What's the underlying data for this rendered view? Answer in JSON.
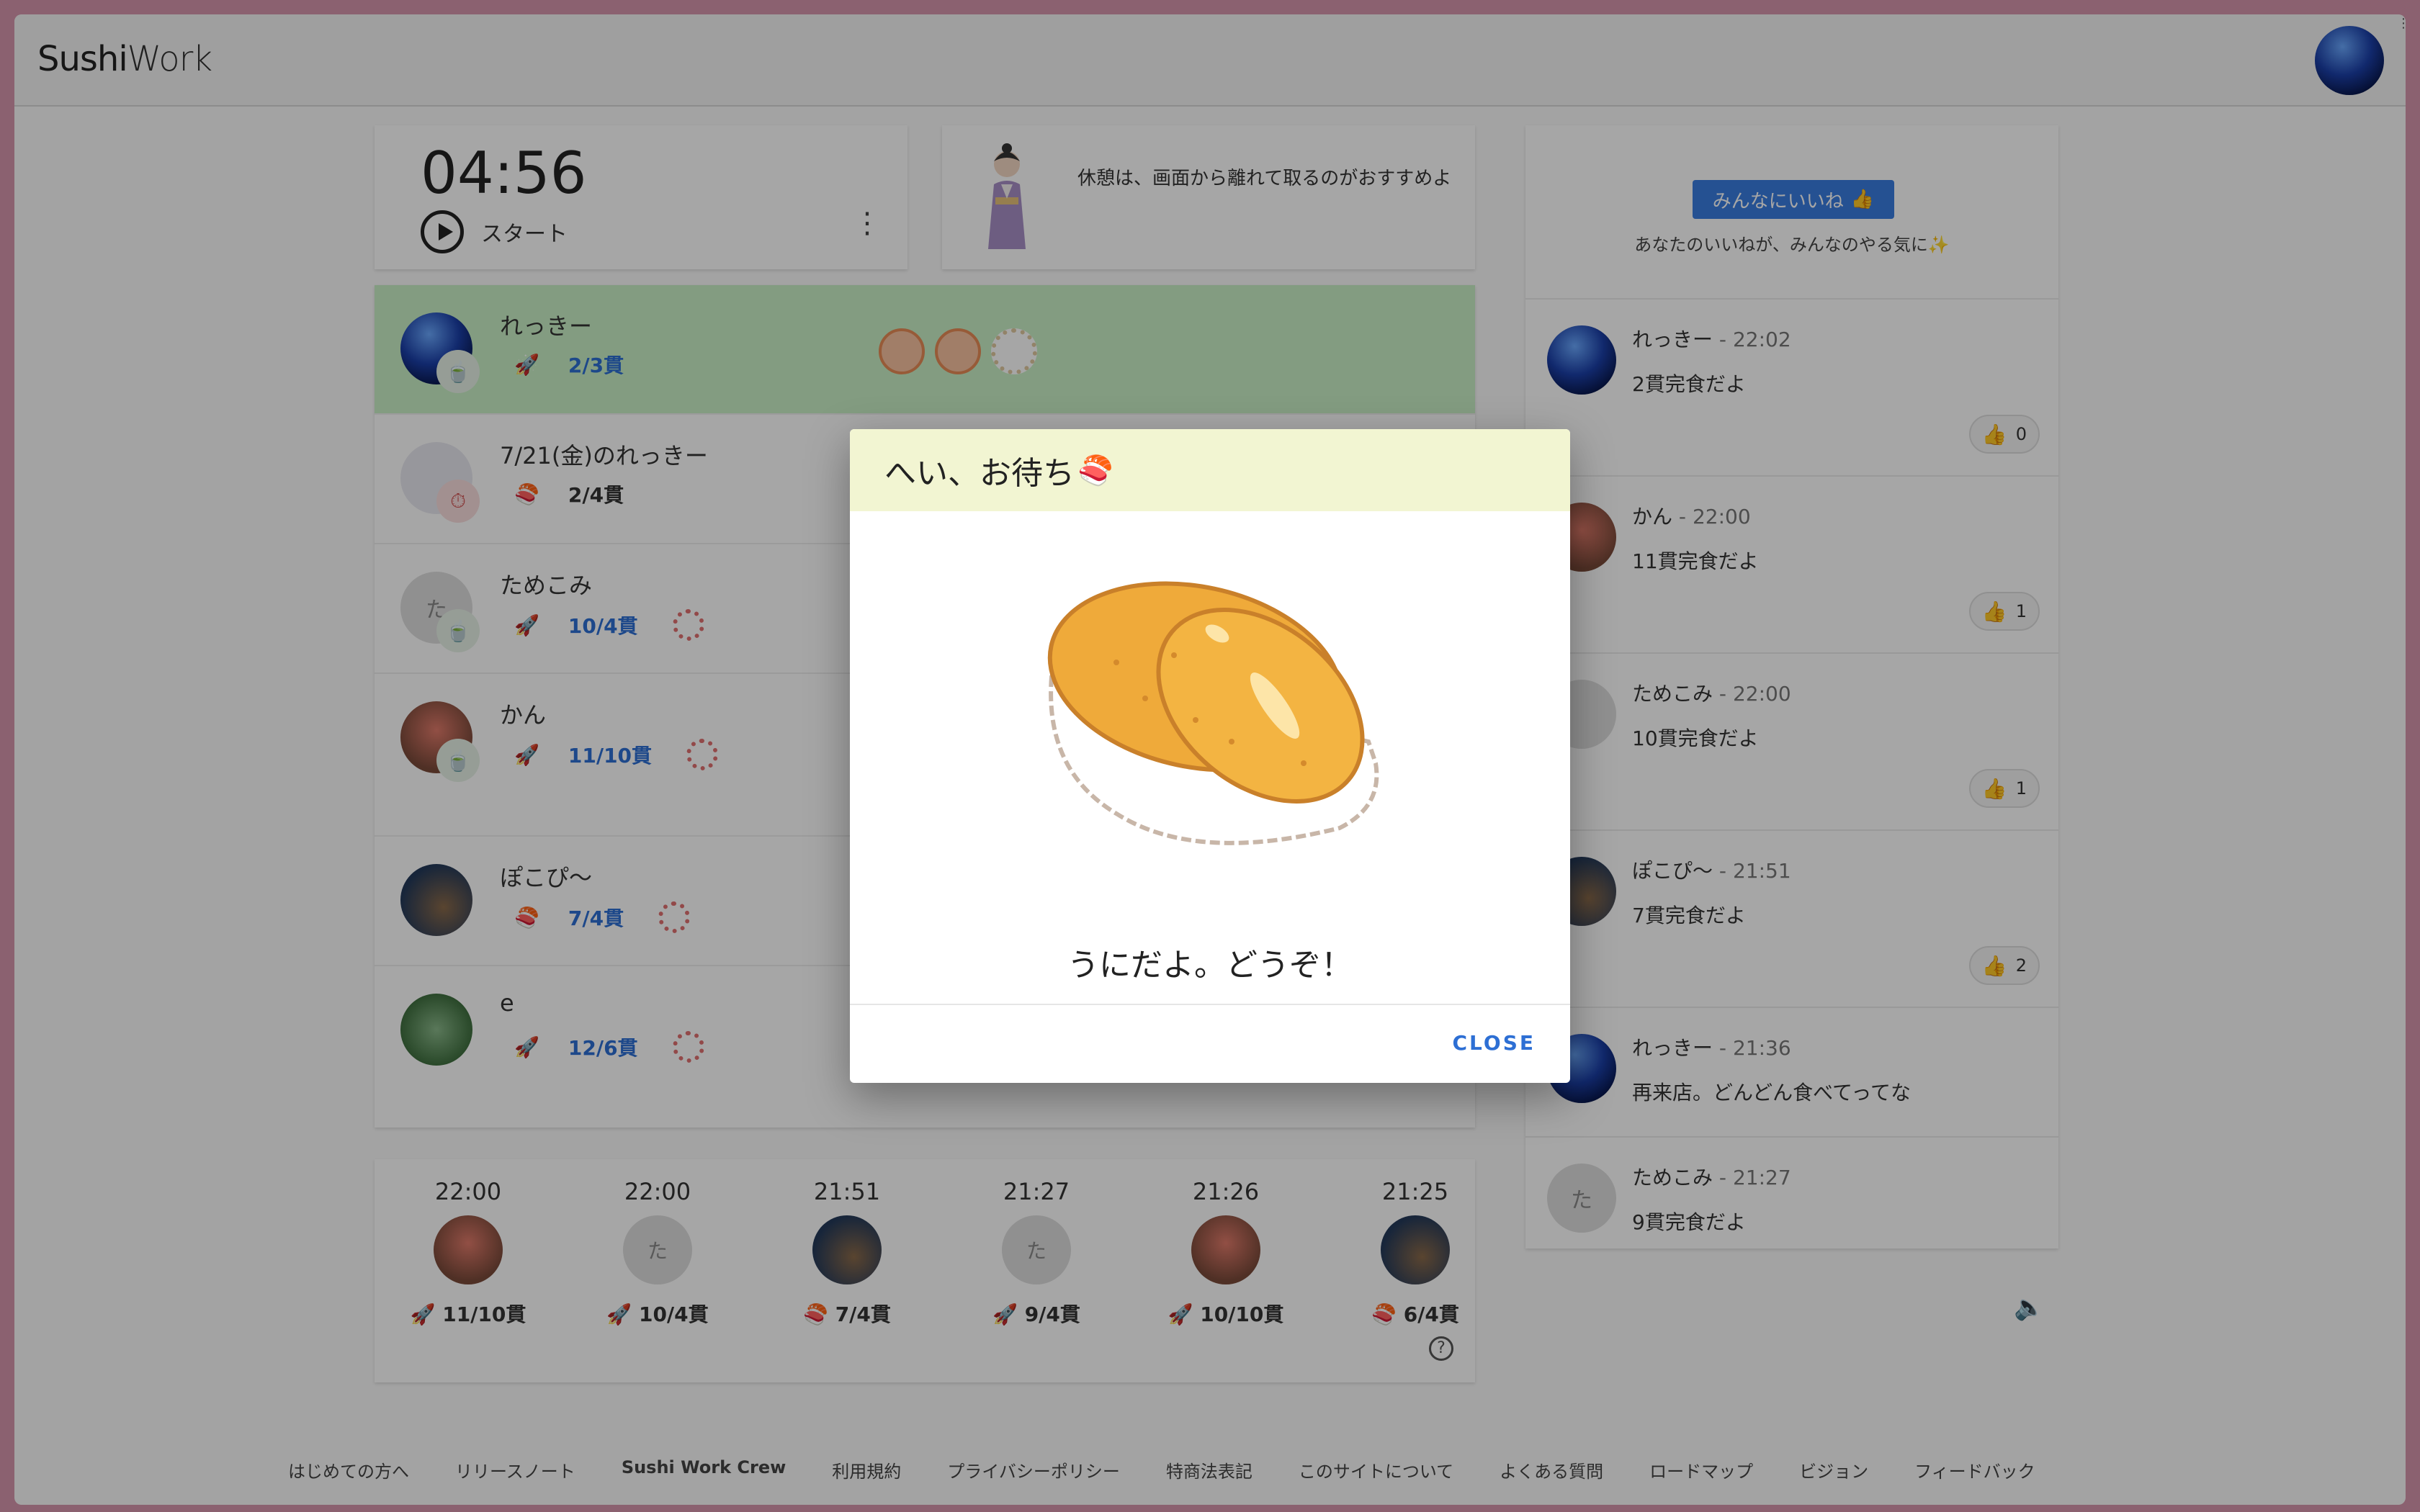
{
  "app": {
    "brand_main": "Sushi",
    "brand_sub": "Work"
  },
  "timer": {
    "time": "04:56",
    "start_label": "スタート"
  },
  "tip": {
    "text": "休憩は、画面から離れて取るのがおすすめよ"
  },
  "queue": [
    {
      "name": "れっきー",
      "count": "2/3貫"
    },
    {
      "name": "7/21(金)のれっきー",
      "count": "2/4貫"
    },
    {
      "name": "ためこみ",
      "count": "10/4貫",
      "avatar_text": "た"
    },
    {
      "name": "かん",
      "count": "11/10貫"
    },
    {
      "name": "ぽこぴ〜",
      "count": "7/4貫"
    },
    {
      "name": "e",
      "count": "12/6貫"
    }
  ],
  "history": [
    {
      "time": "22:00",
      "count": "11/10貫"
    },
    {
      "time": "22:00",
      "count": "10/4貫",
      "avatar_text": "た"
    },
    {
      "time": "21:51",
      "count": "7/4貫"
    },
    {
      "time": "21:27",
      "count": "9/4貫",
      "avatar_text": "た"
    },
    {
      "time": "21:26",
      "count": "10/10貫"
    },
    {
      "time": "21:25",
      "count": "6/4貫"
    }
  ],
  "likes": {
    "button_label": "みんなにいいね",
    "note": "あなたのいいねが、みんなのやる気に✨"
  },
  "feed": [
    {
      "name": "れっきー",
      "time": "22:02",
      "message": "2貫完食だよ",
      "likes": "0"
    },
    {
      "name": "かん",
      "time": "22:00",
      "message": "11貫完食だよ",
      "likes": "1"
    },
    {
      "name": "ためこみ",
      "time": "22:00",
      "message": "10貫完食だよ",
      "likes": "1"
    },
    {
      "name": "ぽこぴ〜",
      "time": "21:51",
      "message": "7貫完食だよ",
      "likes": "2"
    },
    {
      "name": "れっきー",
      "time": "21:36",
      "message": "再来店。どんどん食べてってな"
    },
    {
      "name": "ためこみ",
      "time": "21:27",
      "message": "9貫完食だよ",
      "avatar_text": "た"
    }
  ],
  "footer": {
    "links": [
      "はじめての方へ",
      "リリースノート",
      "Sushi Work Crew",
      "利用規約",
      "プライバシーポリシー",
      "特商法表記",
      "このサイトについて",
      "よくある質問",
      "ロードマップ",
      "ビジョン",
      "フィードバック"
    ]
  },
  "dialog": {
    "title": "へい、お待ち",
    "message": "うにだよ。どうぞ！",
    "close_label": "CLOSE"
  },
  "colors": {
    "accent": "#2d6fd4",
    "active_row": "#c9f0c6",
    "dialog_header": "#f2f5d2",
    "like_button": "#3a7de0"
  },
  "icons": {
    "start": "play-circle-icon",
    "menu": "kebab-icon",
    "rocket": "rocket-icon",
    "sushi": "sushi-icon",
    "thumb": "thumbs-up-icon",
    "speaker": "speaker-icon",
    "help": "help-circle-icon"
  }
}
